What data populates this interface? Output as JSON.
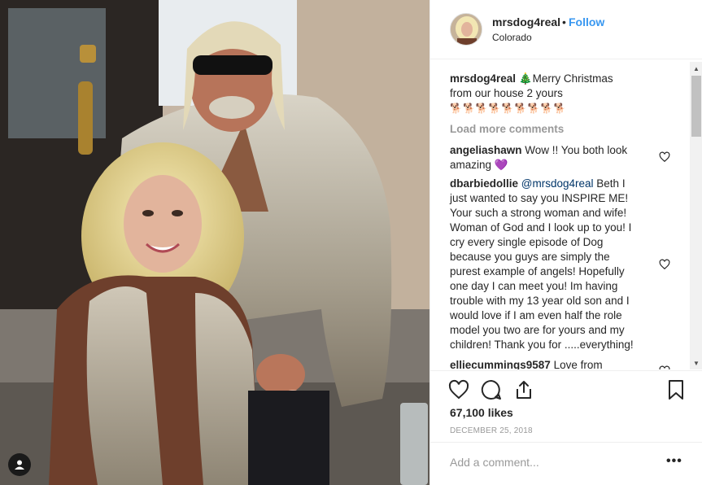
{
  "post": {
    "username": "mrsdog4real",
    "separator": "•",
    "follow_label": "Follow",
    "location": "Colorado"
  },
  "caption": {
    "username": "mrsdog4real",
    "text_1": "Merry Christmas",
    "text_2": "from our house 2 yours",
    "emoji_tree": "🎄",
    "emoji_row": "🐕🐕🐕🐕🐕🐕🐕🐕🐕"
  },
  "load_more_label": "Load more comments",
  "comments": [
    {
      "username": "angeliashawn",
      "text": "Wow !! You both look",
      "text_2": "amazing",
      "emoji": "💜"
    },
    {
      "username": "dbarbiedollie",
      "mention": "@mrsdog4real",
      "lines": [
        "Beth I",
        "just wanted to say you INSPIRE ME!",
        "Your such a strong woman and wife!",
        "Woman of God and I look up to you! I",
        "cry every single episode of Dog",
        "because you guys are simply the",
        "purest example of angels! Hopefully",
        "one day I can meet you! Im having",
        "trouble with my 13 year old son and I",
        "would love if I am even half the role",
        "model you two are for yours and my",
        "children! Thank you for .....everything!"
      ]
    },
    {
      "username": "elliecummings9587",
      "text": "Love from"
    }
  ],
  "likes_label": "67,100 likes",
  "date_label": "DECEMBER 25, 2018",
  "add_comment_placeholder": "Add a comment...",
  "more_label": "•••",
  "colors": {
    "link": "#3897f0",
    "muted": "#999999",
    "text": "#262626",
    "border": "#efefef"
  },
  "icons": [
    "user-tag-icon",
    "heart-icon",
    "comment-icon",
    "share-icon",
    "bookmark-icon",
    "more-options-icon"
  ]
}
